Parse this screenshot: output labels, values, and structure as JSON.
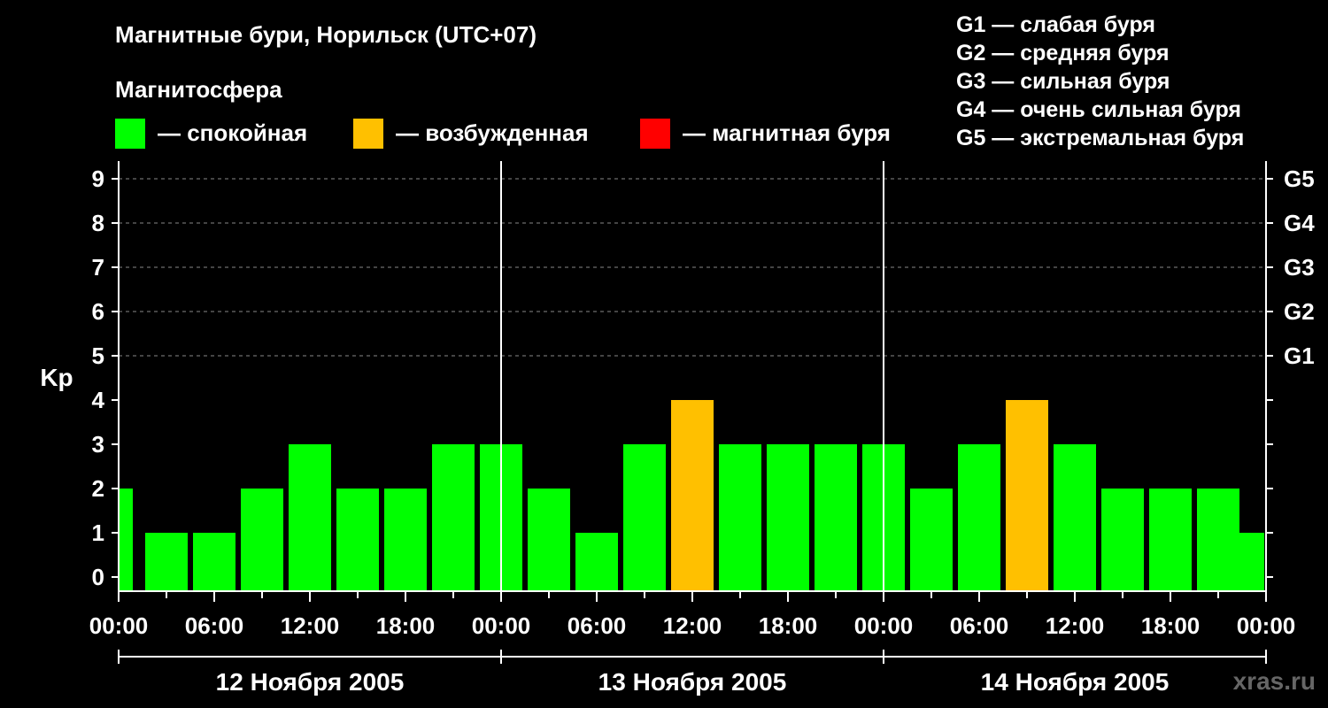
{
  "header": {
    "title": "Магнитные бури, Норильск (UTC+07)",
    "legend_title": "Магнитосфера",
    "legend": [
      {
        "label": "— спокойная",
        "color": "#00ff00"
      },
      {
        "label": "— возбужденная",
        "color": "#ffc000"
      },
      {
        "label": "— магнитная буря",
        "color": "#ff0000"
      }
    ],
    "g_scale": [
      "G1 — слабая буря",
      "G2 — средняя буря",
      "G3 — сильная буря",
      "G4 — очень сильная буря",
      "G5 — экстремальная буря"
    ],
    "watermark": "xras.ru"
  },
  "chart_data": {
    "type": "bar",
    "ylabel": "Kp",
    "ylim": [
      0,
      9
    ],
    "y_ticks": [
      "0",
      "1",
      "2",
      "3",
      "4",
      "5",
      "6",
      "7",
      "8",
      "9"
    ],
    "right_ticks": [
      {
        "value": 5,
        "label": "G1"
      },
      {
        "value": 6,
        "label": "G2"
      },
      {
        "value": 7,
        "label": "G3"
      },
      {
        "value": 8,
        "label": "G4"
      },
      {
        "value": 9,
        "label": "G5"
      }
    ],
    "x_tick_labels": [
      "00:00",
      "06:00",
      "12:00",
      "18:00",
      "00:00",
      "06:00",
      "12:00",
      "18:00",
      "00:00",
      "06:00",
      "12:00",
      "18:00",
      "00:00"
    ],
    "dates": [
      "12 Ноября 2005",
      "13 Ноября 2005",
      "14 Ноября 2005"
    ],
    "colors": {
      "quiet": "#00ff00",
      "active": "#ffc000",
      "storm": "#ff0000"
    },
    "bars": [
      {
        "hour": 0,
        "kp": 2,
        "state": "quiet"
      },
      {
        "hour": 3,
        "kp": 1,
        "state": "quiet"
      },
      {
        "hour": 6,
        "kp": 1,
        "state": "quiet"
      },
      {
        "hour": 9,
        "kp": 2,
        "state": "quiet"
      },
      {
        "hour": 12,
        "kp": 3,
        "state": "quiet"
      },
      {
        "hour": 15,
        "kp": 2,
        "state": "quiet"
      },
      {
        "hour": 18,
        "kp": 2,
        "state": "quiet"
      },
      {
        "hour": 21,
        "kp": 3,
        "state": "quiet"
      },
      {
        "hour": 24,
        "kp": 3,
        "state": "quiet"
      },
      {
        "hour": 27,
        "kp": 2,
        "state": "quiet"
      },
      {
        "hour": 30,
        "kp": 1,
        "state": "quiet"
      },
      {
        "hour": 33,
        "kp": 3,
        "state": "quiet"
      },
      {
        "hour": 36,
        "kp": 4,
        "state": "active"
      },
      {
        "hour": 39,
        "kp": 3,
        "state": "quiet"
      },
      {
        "hour": 42,
        "kp": 3,
        "state": "quiet"
      },
      {
        "hour": 45,
        "kp": 3,
        "state": "quiet"
      },
      {
        "hour": 48,
        "kp": 3,
        "state": "quiet"
      },
      {
        "hour": 51,
        "kp": 2,
        "state": "quiet"
      },
      {
        "hour": 54,
        "kp": 3,
        "state": "quiet"
      },
      {
        "hour": 57,
        "kp": 4,
        "state": "active"
      },
      {
        "hour": 60,
        "kp": 3,
        "state": "quiet"
      },
      {
        "hour": 63,
        "kp": 2,
        "state": "quiet"
      },
      {
        "hour": 66,
        "kp": 2,
        "state": "quiet"
      },
      {
        "hour": 69,
        "kp": 2,
        "state": "quiet"
      },
      {
        "hour": 72,
        "kp": 1,
        "state": "quiet"
      }
    ]
  }
}
